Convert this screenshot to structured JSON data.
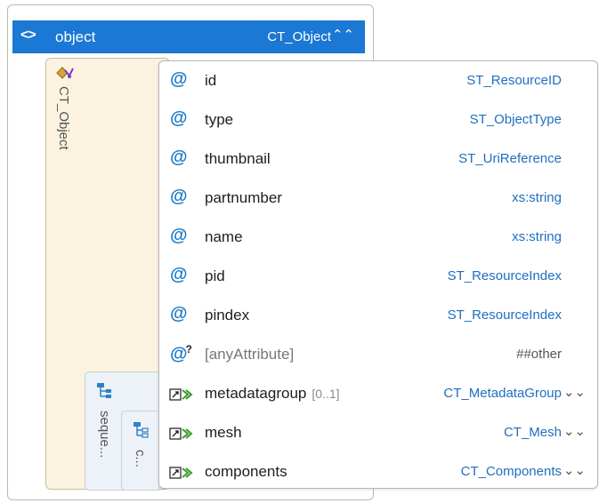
{
  "header": {
    "code_glyph": "<>",
    "title": "object",
    "type": "CT_Object",
    "collapse": "⌃⌃"
  },
  "complex_type": {
    "label": "CT_Object"
  },
  "sequences": [
    {
      "label": "seque..."
    },
    {
      "label": "c..."
    }
  ],
  "colors": {
    "header_bg": "#1b78d4",
    "attribute_icon": "#1a7ac9",
    "type_text": "#1f6fbf",
    "type_box_bg": "#fbf3df",
    "sequence_bg": "#edf2f8"
  },
  "rows": [
    {
      "icon": "attribute-icon",
      "name": "id",
      "card": "",
      "type": "ST_ResourceID"
    },
    {
      "icon": "attribute-icon",
      "name": "type",
      "card": "",
      "type": "ST_ObjectType"
    },
    {
      "icon": "attribute-icon",
      "name": "thumbnail",
      "card": "",
      "type": "ST_UriReference"
    },
    {
      "icon": "attribute-icon",
      "name": "partnumber",
      "card": "",
      "type": "xs:string"
    },
    {
      "icon": "attribute-icon",
      "name": "name",
      "card": "",
      "type": "xs:string"
    },
    {
      "icon": "attribute-icon",
      "name": "pid",
      "card": "",
      "type": "ST_ResourceIndex"
    },
    {
      "icon": "attribute-icon",
      "name": "pindex",
      "card": "",
      "type": "ST_ResourceIndex"
    },
    {
      "icon": "any-attribute-icon",
      "name": "[anyAttribute]",
      "card": "",
      "type": "##other"
    },
    {
      "icon": "element-ref-icon",
      "name": "metadatagroup",
      "card": "[0..1]",
      "type": "CT_MetadataGroup",
      "expand": "⌄⌄"
    },
    {
      "icon": "element-ref-icon",
      "name": "mesh",
      "card": "",
      "type": "CT_Mesh",
      "expand": "⌄⌄"
    },
    {
      "icon": "element-ref-icon",
      "name": "components",
      "card": "",
      "type": "CT_Components",
      "expand": "⌄⌄"
    }
  ]
}
